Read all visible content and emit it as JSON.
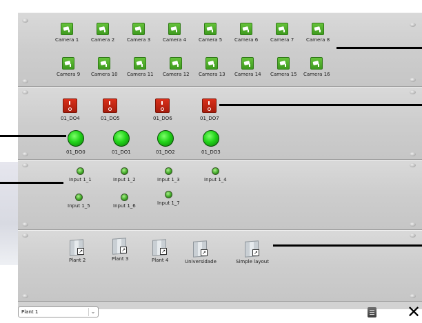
{
  "cameras": [
    "Camera 1",
    "Camera 2",
    "Camera 3",
    "Camera 4",
    "Camera 5",
    "Camera 6",
    "Camera 7",
    "Camera 8",
    "Camera 9",
    "Camera 10",
    "Camera 11",
    "Camera 12",
    "Camera 13",
    "Camera 14",
    "Camera 15",
    "Camera 16"
  ],
  "outputs": [
    "01_DO4",
    "01_DO5",
    "01_DO6",
    "01_DO7"
  ],
  "lamps": [
    "01_DO0",
    "01_DO1",
    "01_DO2",
    "01_DO3"
  ],
  "inputs": [
    "Input 1_1",
    "Input 1_2",
    "Input 1_3",
    "Input 1_4",
    "Input 1_5",
    "Input 1_6",
    "Input 1_7"
  ],
  "layouts": [
    "Plant 2",
    "Plant 3",
    "Plant 4",
    "Universidade",
    "Simple layout"
  ],
  "footer": {
    "plant_select": "Plant 1",
    "chevron_icon": "chevron-down-icon",
    "notes_icon": "notes-icon",
    "close_icon": "close-icon",
    "close_glyph": "✕"
  },
  "colors": {
    "camera_green": "#4caf2a",
    "switch_red": "#c8281a",
    "lamp_green": "#22d41a"
  }
}
